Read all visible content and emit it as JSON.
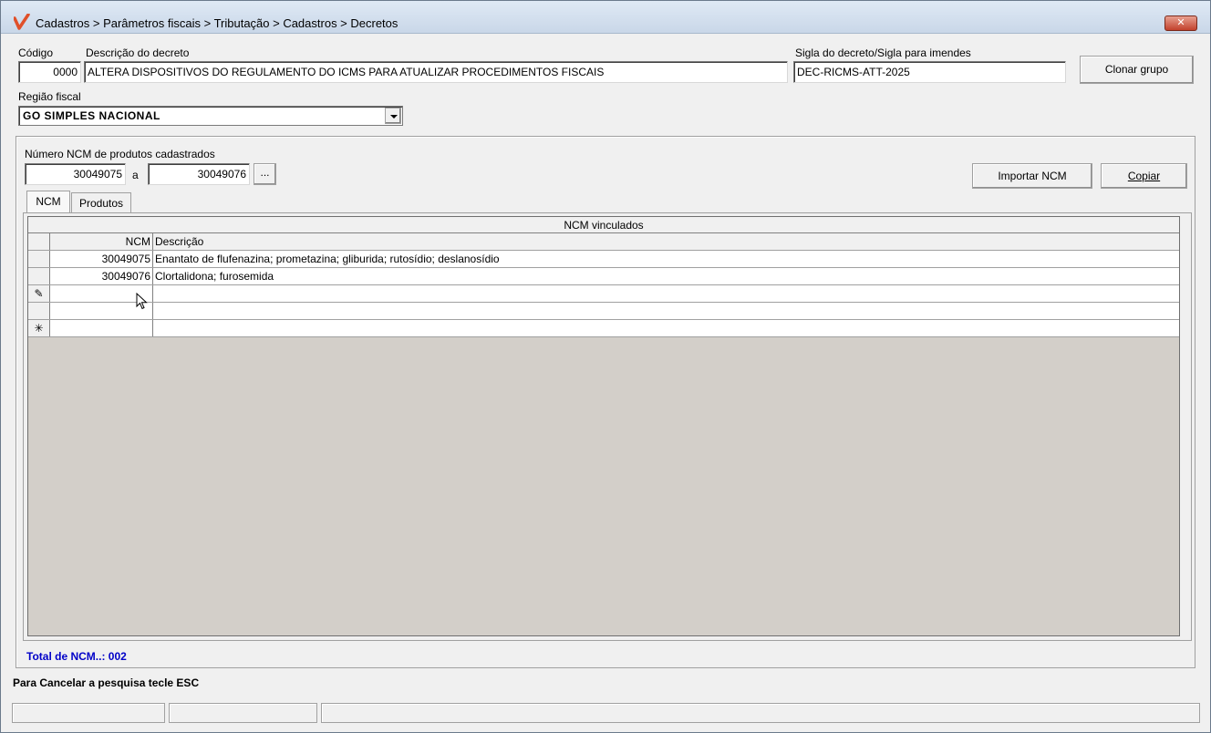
{
  "window": {
    "title": "Cadastros > Parâmetros fiscais > Tributação > Cadastros > Decretos",
    "close_label": "✕",
    "accent_color": "#e0502a"
  },
  "form": {
    "codigo_label": "Código",
    "codigo_value": "0000",
    "descricao_label": "Descrição do decreto",
    "descricao_value": "ALTERA DISPOSITIVOS DO REGULAMENTO DO ICMS PARA ATUALIZAR PROCEDIMENTOS FISCAIS",
    "sigla_label": "Sigla do decreto/Sigla para imendes",
    "sigla_value": "DEC-RICMS-ATT-2025",
    "clonar_label": "Clonar grupo",
    "regiao_label": "Região fiscal",
    "regiao_value": "GO SIMPLES NACIONAL"
  },
  "ncm_filter": {
    "label": "Número  NCM de produtos cadastrados",
    "from_value": "30049075",
    "separator": "a",
    "to_value": "30049076",
    "browse_label": "...",
    "importar_label": "Importar NCM",
    "copiar_label": "Copiar"
  },
  "tabs": [
    {
      "label": "NCM",
      "active": true
    },
    {
      "label": "Produtos",
      "active": false
    }
  ],
  "grid": {
    "caption": "NCM vinculados",
    "columns": [
      "NCM",
      "Descrição"
    ],
    "rows": [
      {
        "ncm": "30049075",
        "descricao": "Enantato de flufenazina; prometazina; gliburida; rutosídio; deslanosídio"
      },
      {
        "ncm": "30049076",
        "descricao": "Clortalidona; furosemida"
      }
    ],
    "edit_indicator": "✎",
    "new_indicator": "✳"
  },
  "footer": {
    "total_label": "Total de NCM..: 002",
    "total_color": "#0000c8",
    "status_message": "Para Cancelar a pesquisa tecle ESC"
  }
}
